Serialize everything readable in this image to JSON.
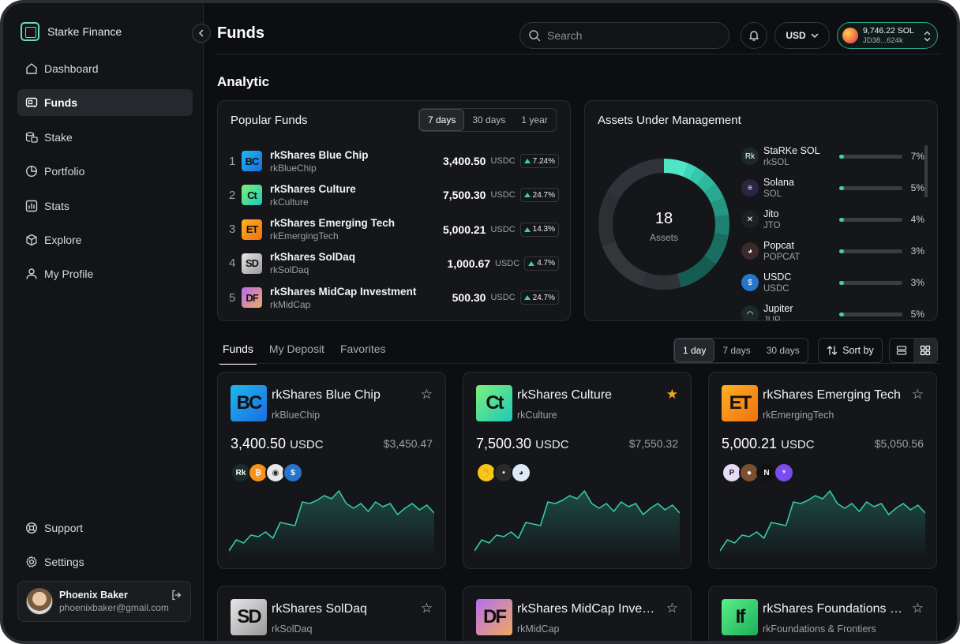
{
  "brand": {
    "name": "Starke Finance"
  },
  "nav": {
    "items": [
      {
        "label": "Dashboard",
        "icon": "home-icon",
        "active": false
      },
      {
        "label": "Funds",
        "icon": "funds-icon",
        "active": true
      },
      {
        "label": "Stake",
        "icon": "stake-icon",
        "active": false
      },
      {
        "label": "Portfolio",
        "icon": "pie-icon",
        "active": false
      },
      {
        "label": "Stats",
        "icon": "stats-icon",
        "active": false
      },
      {
        "label": "Explore",
        "icon": "explore-icon",
        "active": false
      },
      {
        "label": "My Profile",
        "icon": "user-icon",
        "active": false
      }
    ],
    "bottom": [
      {
        "label": "Support",
        "icon": "support-icon"
      },
      {
        "label": "Settings",
        "icon": "gear-icon"
      }
    ]
  },
  "user": {
    "name": "Phoenix Baker",
    "email": "phoenixbaker@gmail.com"
  },
  "header": {
    "title": "Funds",
    "search_placeholder": "Search",
    "currency": "USD",
    "wallet_balance": "9,746.22 SOL",
    "wallet_address": "JD38...624k"
  },
  "analytic": {
    "title": "Analytic"
  },
  "popular": {
    "title": "Popular Funds",
    "ranges": [
      "7 days",
      "30 days",
      "1 year"
    ],
    "active_range": "7 days",
    "funds": [
      {
        "rank": "1",
        "logo": "BC",
        "name": "rkShares Blue Chip",
        "ticker": "rkBlueChip",
        "price": "3,400.50",
        "unit": "USDC",
        "change": "7.24%"
      },
      {
        "rank": "2",
        "logo": "Ct",
        "name": "rkShares Culture",
        "ticker": "rkCulture",
        "price": "7,500.30",
        "unit": "USDC",
        "change": "24.7%"
      },
      {
        "rank": "3",
        "logo": "ET",
        "name": "rkShares Emerging Tech",
        "ticker": "rkEmergingTech",
        "price": "5,000.21",
        "unit": "USDC",
        "change": "14.3%"
      },
      {
        "rank": "4",
        "logo": "SD",
        "name": "rkShares SolDaq",
        "ticker": "rkSolDaq",
        "price": "1,000.67",
        "unit": "USDC",
        "change": "4.7%"
      },
      {
        "rank": "5",
        "logo": "DF",
        "name": "rkShares MidCap Investment",
        "ticker": "rkMidCap",
        "price": "500.30",
        "unit": "USDC",
        "change": "24.7%"
      }
    ]
  },
  "aum": {
    "title": "Assets Under Management",
    "count": "18",
    "count_label": "Assets",
    "assets": [
      {
        "name": "StaRKe SOL",
        "ticker": "rkSOL",
        "pct": "7%",
        "fill": 0.07,
        "icon": "rk-icon",
        "color": "#1c2b2a"
      },
      {
        "name": "Solana",
        "ticker": "SOL",
        "pct": "5%",
        "fill": 0.05,
        "icon": "solana-icon",
        "color": "#2a2540"
      },
      {
        "name": "Jito",
        "ticker": "JTO",
        "pct": "4%",
        "fill": 0.04,
        "icon": "jito-icon",
        "color": "#1e2024"
      },
      {
        "name": "Popcat",
        "ticker": "POPCAT",
        "pct": "3%",
        "fill": 0.03,
        "icon": "popcat-icon",
        "color": "#3a2a2a"
      },
      {
        "name": "USDC",
        "ticker": "USDC",
        "pct": "3%",
        "fill": 0.03,
        "icon": "usdc-icon",
        "color": "#2775ca"
      },
      {
        "name": "Jupiter",
        "ticker": "JUP",
        "pct": "5%",
        "fill": 0.05,
        "icon": "jupiter-icon",
        "color": "#1b2a24"
      }
    ]
  },
  "tabs": {
    "items": [
      "Funds",
      "My Deposit",
      "Favorites"
    ],
    "active": "Funds",
    "ranges": [
      "1 day",
      "7 days",
      "30 days"
    ],
    "active_range": "1 day",
    "sort_label": "Sort by"
  },
  "cards": [
    {
      "logo": "BC",
      "name": "rkShares Blue Chip",
      "ticker": "rkBlueChip",
      "price": "3,400.50",
      "unit": "USDC",
      "alt": "$3,450.47",
      "favorite": false,
      "holdings": [
        "rk-icon",
        "bitcoin-icon",
        "wif-icon",
        "dollar-icon"
      ]
    },
    {
      "logo": "Ct",
      "name": "rkShares Culture",
      "ticker": "rkCulture",
      "price": "7,500.30",
      "unit": "USDC",
      "alt": "$7,550.32",
      "favorite": true,
      "holdings": [
        "hand-icon",
        "meme-icon",
        "penguin-icon"
      ]
    },
    {
      "logo": "ET",
      "name": "rkShares Emerging Tech",
      "ticker": "rkEmergingTech",
      "price": "5,000.21",
      "unit": "USDC",
      "alt": "$5,050.56",
      "favorite": false,
      "holdings": [
        "pyth-icon",
        "avatar-icon",
        "render-icon",
        "bubble-icon"
      ]
    },
    {
      "logo": "SD",
      "name": "rkShares SolDaq",
      "ticker": "rkSolDaq",
      "favorite": false
    },
    {
      "logo": "DF",
      "name": "rkShares MidCap Investment",
      "ticker": "rkMidCap",
      "favorite": false
    },
    {
      "logo": "If",
      "name": "rkShares Foundations & Frontiers",
      "ticker": "rkFoundations & Frontiers",
      "favorite": false
    }
  ],
  "colors": {
    "accent": "#3ad3b0",
    "positive": "#36d39a",
    "favorite": "#f5a623"
  }
}
